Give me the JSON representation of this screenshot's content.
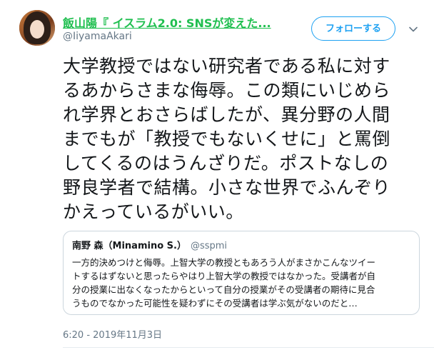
{
  "author": {
    "display_name": "飯山陽『 イスラム2.0: SNSが変えた...",
    "handle": "@IiyamaAkari"
  },
  "follow_button": {
    "label": "フォローする"
  },
  "tweet": {
    "lines": [
      "大学教授ではない研究者である私に対す",
      "るあからさまな侮辱。この類にいじめら",
      "れ学界とおさらばしたが、異分野の人間",
      "までもが「教授でもないくせに」と罵倒",
      "してくるのはうんざりだ。ポストなしの",
      "野良学者で結構。小さな世界でふんぞり",
      "かえっているがいい。"
    ],
    "timestamp": "6:20 - 2019年11月3日"
  },
  "quote": {
    "name": "南野 森（Minamino S.）",
    "handle": "@sspmi",
    "lines": [
      "一方的決めつけと侮辱。上智大学の教授ともあろう人がまさかこんなツイー",
      "トするはずないと思ったらやはり上智大学の教授ではなかった。受講者が自",
      "分の授業に出なくなったからといって自分の授業がその受講者の期待に見合",
      "うものでなかった可能性を疑わずにその受講者は学ぶ気がないのだと…"
    ]
  },
  "icons": {
    "more": "chevron-down-icon"
  },
  "colors": {
    "display_name": "#1fbf4f",
    "accent": "#1da1f2",
    "secondary_text": "#657786",
    "border": "#ccd6dd"
  }
}
